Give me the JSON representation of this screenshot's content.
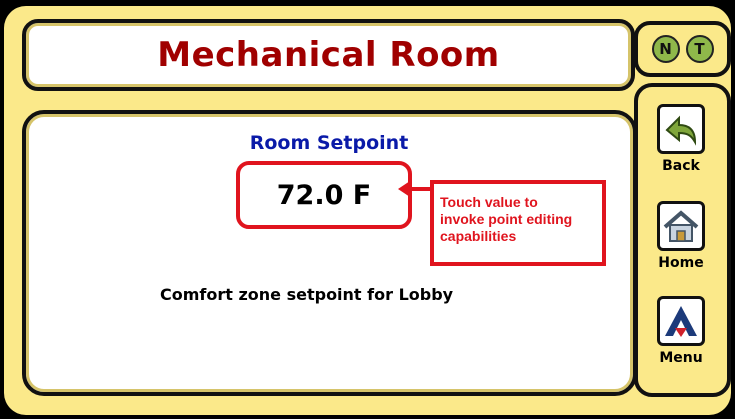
{
  "header": {
    "title": "Mechanical Room"
  },
  "status_indicators": [
    {
      "label": "N"
    },
    {
      "label": "T"
    }
  ],
  "setpoint": {
    "label": "Room Setpoint",
    "value": "72.0 F",
    "description": "Comfort zone setpoint for Lobby"
  },
  "callout": {
    "text": "Touch value to\ninvoke point editing\ncapabilities"
  },
  "nav": [
    {
      "label": "Back",
      "icon": "back-arrow-icon"
    },
    {
      "label": "Home",
      "icon": "home-icon"
    },
    {
      "label": "Menu",
      "icon": "menu-logo-icon"
    }
  ],
  "colors": {
    "background": "#fbe98a",
    "title": "#a00000",
    "setpoint_label": "#0a1aa8",
    "highlight": "#e0141e"
  }
}
